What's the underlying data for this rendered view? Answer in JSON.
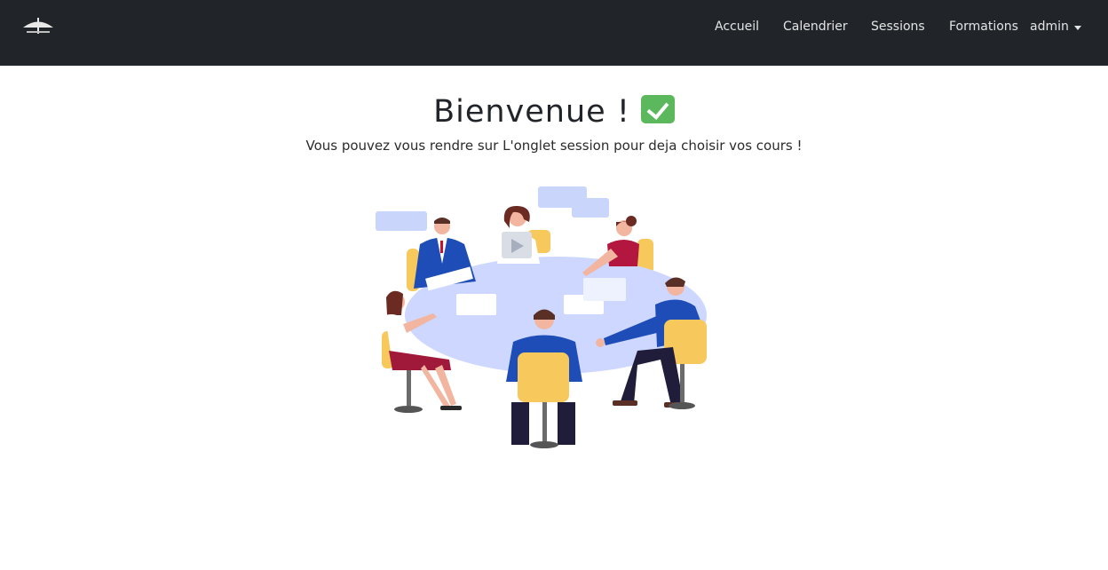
{
  "navbar": {
    "brand_icon": "umbrella-logo-icon",
    "links": [
      "Accueil",
      "Calendrier",
      "Sessions",
      "Formations"
    ],
    "user_menu": "admin"
  },
  "main": {
    "title": "Bienvenue !",
    "title_icon": "check-mark-button-icon",
    "subtitle": "Vous pouvez vous rendre sur L'onglet session pour deja choisir vos cours !",
    "illustration": "team-meeting-illustration"
  },
  "colors": {
    "navbar_bg": "#212529",
    "check_green": "#5cb85c",
    "table": "#cdd7ff",
    "chair": "#f7c95c",
    "jacket_blue": "#1e4db7"
  }
}
